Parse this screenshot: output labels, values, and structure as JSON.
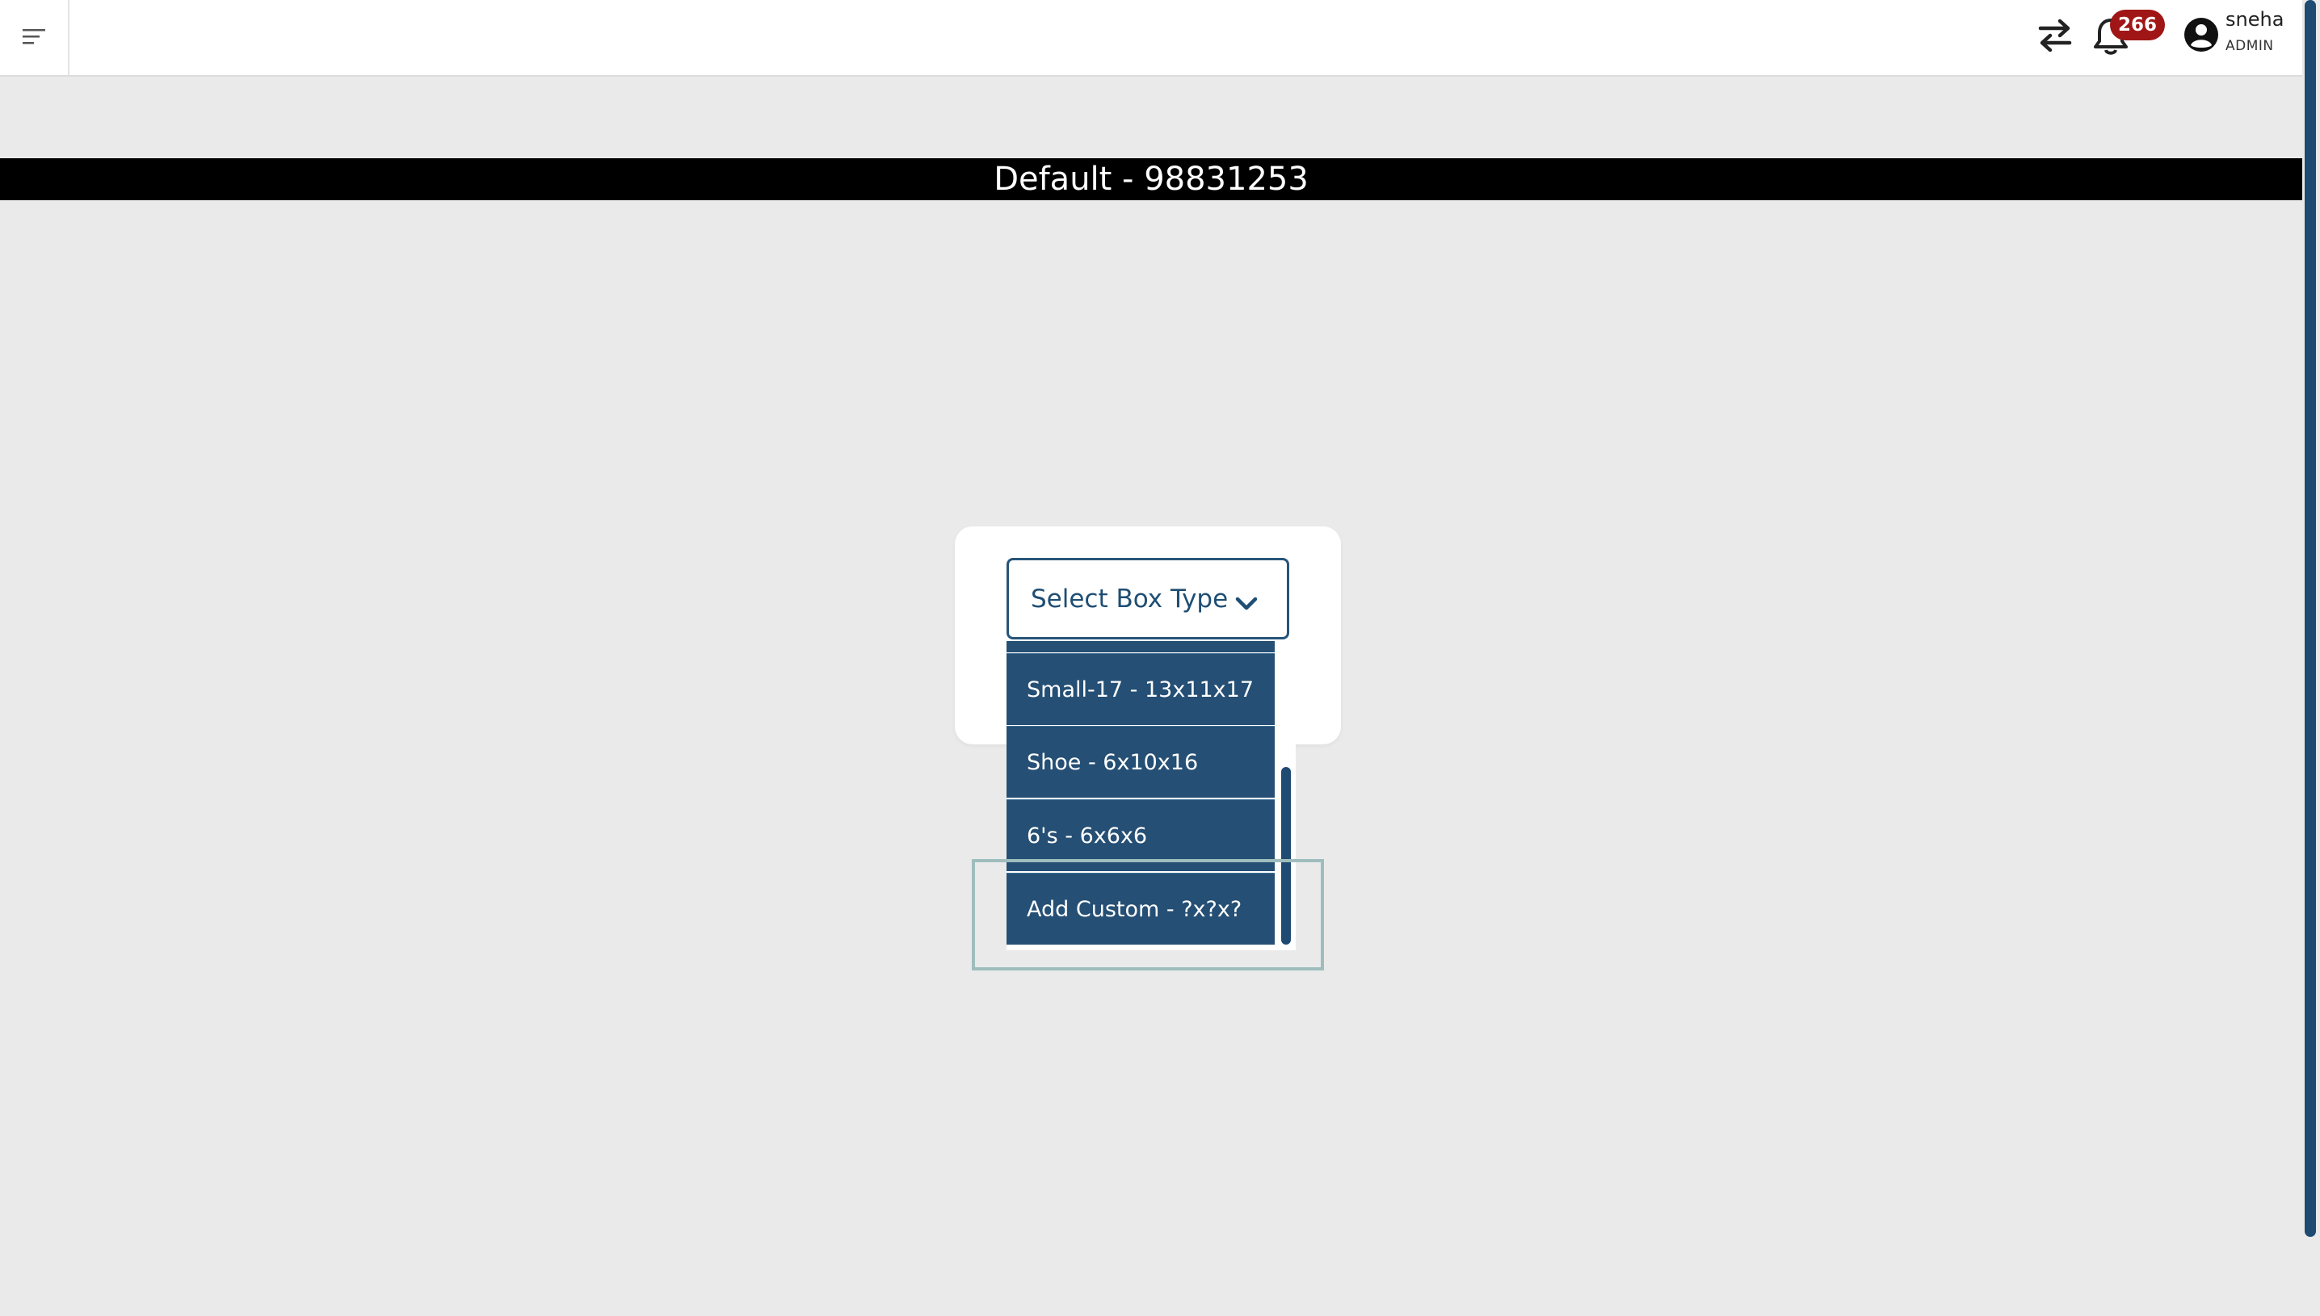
{
  "header": {
    "notification_count": "266",
    "user_name": "sneha",
    "user_role": "ADMIN"
  },
  "title": "Default - 98831253",
  "select": {
    "placeholder": "Select Box Type"
  },
  "options": [
    {
      "label": "Small-17 - 13x11x17"
    },
    {
      "label": "Shoe - 6x10x16"
    },
    {
      "label": "6's - 6x6x6"
    },
    {
      "label": "Add Custom - ?x?x?"
    }
  ],
  "colors": {
    "accent": "#254f74",
    "badge": "#a01616",
    "background": "#eaeaea"
  }
}
